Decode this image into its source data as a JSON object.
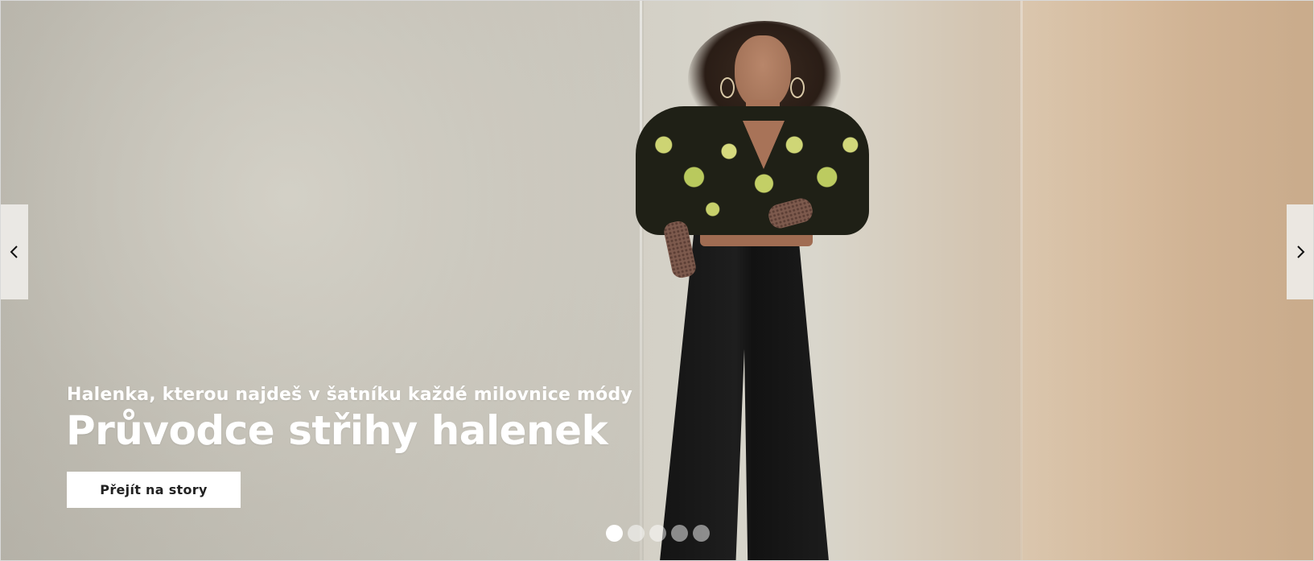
{
  "hero": {
    "subtitle": "Halenka, kterou najdeš v šatníku každé milovnice módy",
    "title": "Průvodce střihy halenek",
    "cta_label": "Přejít na story"
  },
  "carousel": {
    "prev_icon": "chevron-left-icon",
    "next_icon": "chevron-right-icon",
    "slide_count": 5,
    "active_index": 0
  },
  "colors": {
    "text": "#ffffff",
    "button_bg": "#ffffff",
    "button_text": "#222222"
  }
}
